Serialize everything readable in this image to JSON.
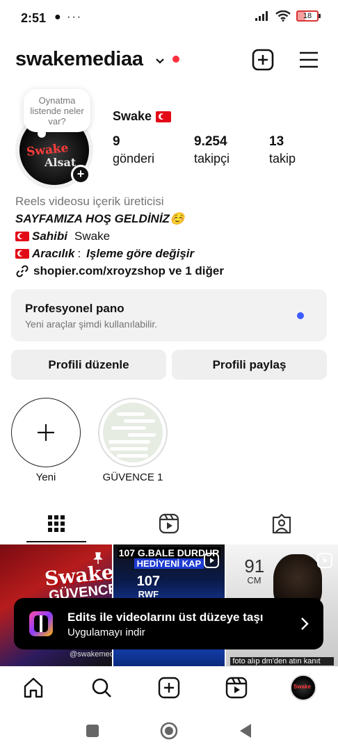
{
  "status_bar": {
    "time": "2:51",
    "left_icons": "● ···",
    "battery": "18"
  },
  "header": {
    "username": "swakemediaa",
    "chevron": "⌵"
  },
  "profile": {
    "note": "Oynatma listende neler var?",
    "avatar_text_1": "Swake",
    "avatar_text_2": "Alsat",
    "display_name": "Swake",
    "stats": [
      {
        "value": "9",
        "label": "gönderi"
      },
      {
        "value": "9.254",
        "label": "takipçi"
      },
      {
        "value": "13",
        "label": "takip"
      }
    ]
  },
  "bio": {
    "category": "Reels videosu içerik üreticisi",
    "welcome": "SAYFAMIZA HOŞ GELDİNİZ☺️",
    "owner_label": "Sahibi",
    "owner_value": "Swake",
    "agent_label": "Aracılık",
    "agent_value": "Işleme göre değişir",
    "link": "shopier.com/xroyzshop ve 1 diğer"
  },
  "pro_dashboard": {
    "title": "Profesyonel pano",
    "subtitle": "Yeni araçlar şimdi kullanılabilir."
  },
  "actions": {
    "edit_profile": "Profili düzenle",
    "share_profile": "Profili paylaş"
  },
  "highlights": [
    {
      "label": "Yeni",
      "icon": "plus-icon"
    },
    {
      "label": "GÜVENCE 1",
      "icon": "chat-screenshot"
    }
  ],
  "tabs": [
    {
      "icon": "grid-icon",
      "active": true
    },
    {
      "icon": "reels-icon",
      "active": false
    },
    {
      "icon": "tagged-icon",
      "active": false
    }
  ],
  "posts": [
    {
      "title": "Swake",
      "subtitle": "GÜVENCE",
      "watermark": "@swakemedi",
      "pinned": true
    },
    {
      "title": "107 G.BALE DURDUR",
      "subtitle": "HEDİYENİ KAP",
      "rating": "107",
      "position": "RWF"
    },
    {
      "rating": "91",
      "position": "CM",
      "caption": "foto alıp dm'den atın kanıt"
    }
  ],
  "banner": {
    "title": "Edits ile videolarını üst düzeye taşı",
    "subtitle": "Uygulamayı indir"
  },
  "bottom_nav": {
    "avatar_text": "Swake"
  },
  "colors": {
    "notification_dot": "#ff3040",
    "unread_dot": "#3b5cff",
    "button_bg": "#efeff0"
  }
}
